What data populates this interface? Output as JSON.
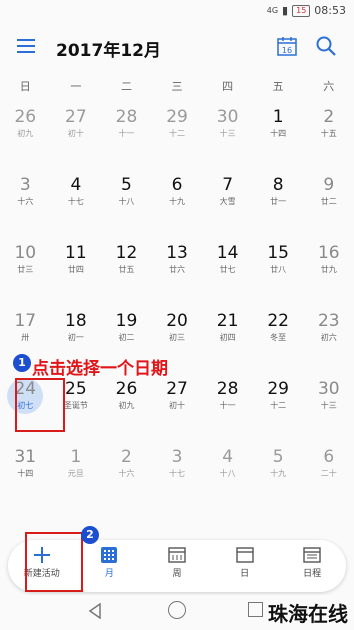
{
  "status_bar": {
    "network": "4G",
    "battery": "15",
    "time": "08:53"
  },
  "header": {
    "title": "2017年12月",
    "calendar_icon_day": "16"
  },
  "weekdays": [
    "日",
    "一",
    "二",
    "三",
    "四",
    "五",
    "六"
  ],
  "weeks": [
    [
      {
        "d": "26",
        "l": "初九",
        "o": true
      },
      {
        "d": "27",
        "l": "初十",
        "o": true
      },
      {
        "d": "28",
        "l": "十一",
        "o": true
      },
      {
        "d": "29",
        "l": "十二",
        "o": true
      },
      {
        "d": "30",
        "l": "十三",
        "o": true
      },
      {
        "d": "1",
        "l": "十四"
      },
      {
        "d": "2",
        "l": "十五"
      }
    ],
    [
      {
        "d": "3",
        "l": "十六"
      },
      {
        "d": "4",
        "l": "十七"
      },
      {
        "d": "5",
        "l": "十八"
      },
      {
        "d": "6",
        "l": "十九"
      },
      {
        "d": "7",
        "l": "大雪"
      },
      {
        "d": "8",
        "l": "廿一"
      },
      {
        "d": "9",
        "l": "廿二"
      }
    ],
    [
      {
        "d": "10",
        "l": "廿三"
      },
      {
        "d": "11",
        "l": "廿四"
      },
      {
        "d": "12",
        "l": "廿五"
      },
      {
        "d": "13",
        "l": "廿六"
      },
      {
        "d": "14",
        "l": "廿七"
      },
      {
        "d": "15",
        "l": "廿八"
      },
      {
        "d": "16",
        "l": "廿九"
      }
    ],
    [
      {
        "d": "17",
        "l": "卅"
      },
      {
        "d": "18",
        "l": "初一"
      },
      {
        "d": "19",
        "l": "初二"
      },
      {
        "d": "20",
        "l": "初三"
      },
      {
        "d": "21",
        "l": "初四"
      },
      {
        "d": "22",
        "l": "冬至"
      },
      {
        "d": "23",
        "l": "初六"
      }
    ],
    [
      {
        "d": "24",
        "l": "初七",
        "s": true
      },
      {
        "d": "25",
        "l": "圣诞节"
      },
      {
        "d": "26",
        "l": "初九"
      },
      {
        "d": "27",
        "l": "初十"
      },
      {
        "d": "28",
        "l": "十一"
      },
      {
        "d": "29",
        "l": "十二"
      },
      {
        "d": "30",
        "l": "十三"
      }
    ],
    [
      {
        "d": "31",
        "l": "十四"
      },
      {
        "d": "1",
        "l": "元旦",
        "o": true
      },
      {
        "d": "2",
        "l": "十六",
        "o": true
      },
      {
        "d": "3",
        "l": "十七",
        "o": true
      },
      {
        "d": "4",
        "l": "十八",
        "o": true
      },
      {
        "d": "5",
        "l": "十九",
        "o": true
      },
      {
        "d": "6",
        "l": "二十",
        "o": true
      }
    ]
  ],
  "annotation": {
    "step1_badge": "1",
    "step1_text": "点击选择一个日期",
    "step2_badge": "2"
  },
  "tabs": [
    {
      "label": "新建活动",
      "icon": "plus-icon"
    },
    {
      "label": "月",
      "icon": "month-grid-icon",
      "active": true
    },
    {
      "label": "周",
      "icon": "week-icon"
    },
    {
      "label": "日",
      "icon": "day-icon"
    },
    {
      "label": "日程",
      "icon": "agenda-icon"
    }
  ],
  "watermark": "珠海在线",
  "colors": {
    "accent": "#2a6fd6",
    "highlight": "#d81b1b",
    "badge": "#1b4fd0"
  }
}
